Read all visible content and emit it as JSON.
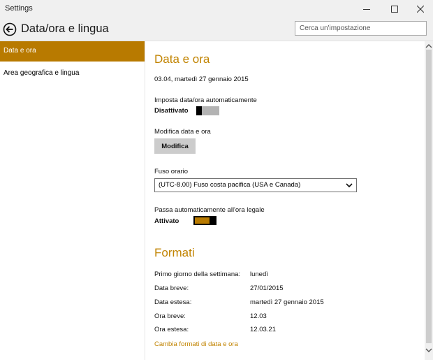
{
  "window": {
    "title": "Settings"
  },
  "header": {
    "page_title": "Data/ora e lingua",
    "search_placeholder": "Cerca un'impostazione"
  },
  "sidebar": {
    "items": [
      {
        "label": "Data e ora",
        "active": true
      },
      {
        "label": "Area geografica e lingua",
        "active": false
      }
    ]
  },
  "date_time": {
    "heading": "Data e ora",
    "current": "03.04, martedì 27 gennaio 2015",
    "auto_label": "Imposta data/ora automaticamente",
    "auto_state": "Disattivato",
    "modify_label": "Modifica data e ora",
    "modify_button": "Modifica",
    "timezone_label": "Fuso orario",
    "timezone_value": "(UTC-8.00) Fuso costa pacifica (USA e Canada)",
    "dst_label": "Passa automaticamente all'ora legale",
    "dst_state": "Attivato"
  },
  "formats": {
    "heading": "Formati",
    "rows": [
      {
        "label": "Primo giorno della settimana:",
        "value": "lunedì"
      },
      {
        "label": "Data breve:",
        "value": "27/01/2015"
      },
      {
        "label": "Data estesa:",
        "value": "martedì 27 gennaio 2015"
      },
      {
        "label": "Ora breve:",
        "value": "12.03"
      },
      {
        "label": "Ora estesa:",
        "value": "12.03.21"
      }
    ],
    "change_link": "Cambia formati di data e ora"
  },
  "colors": {
    "accent": "#b87a00",
    "heading": "#c18300"
  },
  "icons": {
    "back": "back-arrow-circle-icon",
    "minimize": "minimize-icon",
    "maximize": "maximize-icon",
    "close": "close-icon",
    "dropdown": "chevron-down-icon"
  }
}
